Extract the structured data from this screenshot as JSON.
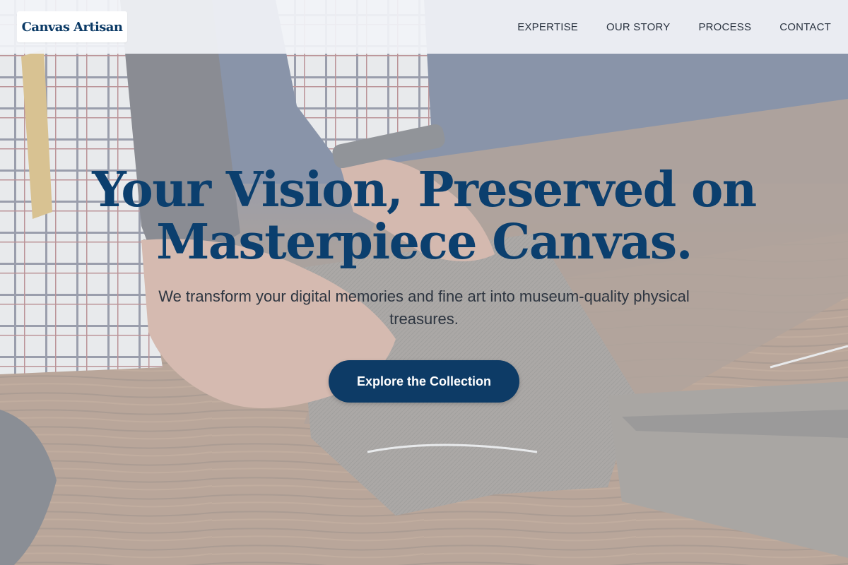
{
  "header": {
    "logo_text": "Canvas Artisan",
    "nav": [
      {
        "label": "EXPERTISE"
      },
      {
        "label": "OUR STORY"
      },
      {
        "label": "PROCESS"
      },
      {
        "label": "CONTACT"
      }
    ]
  },
  "hero": {
    "title": "Your Vision, Preserved on Masterpiece Canvas.",
    "subtitle": "We transform your digital memories and fine art into museum-quality physical treasures.",
    "cta_label": "Explore the Collection"
  },
  "colors": {
    "brand": "#0b3f6e",
    "button": "#0d3b66",
    "button_text": "#ffffff",
    "body_text": "#2d3540",
    "header_bg": "#f1f3f7"
  },
  "background": {
    "icon": "tailor-workbench-photo"
  }
}
